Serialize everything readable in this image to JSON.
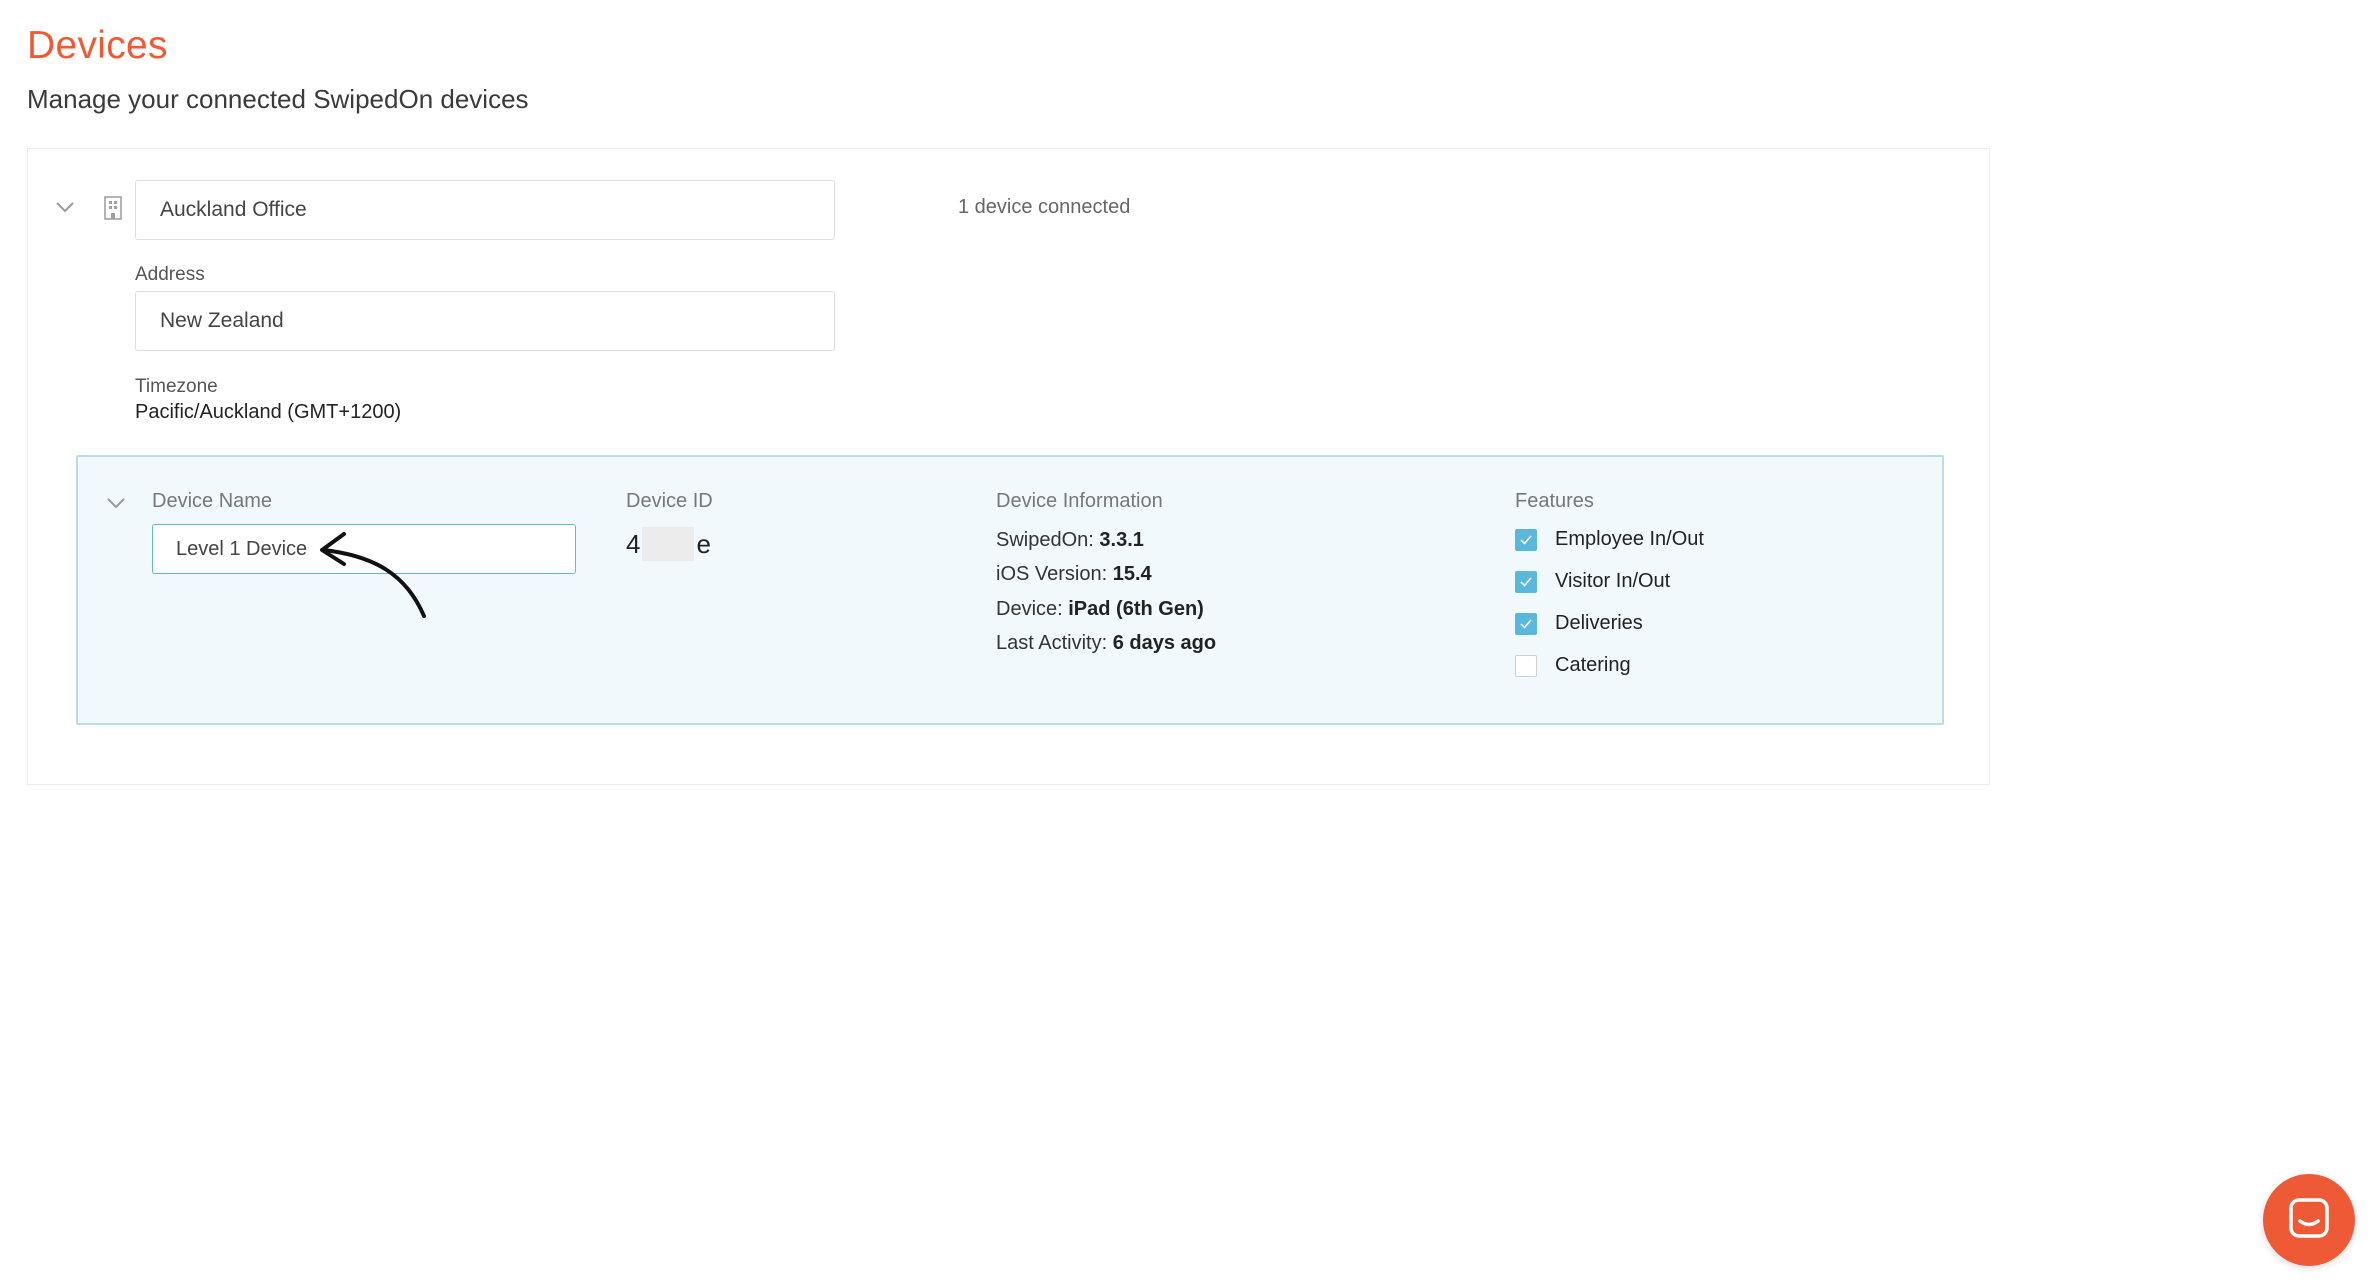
{
  "header": {
    "title": "Devices",
    "subtitle": "Manage your connected SwipedOn devices"
  },
  "location": {
    "name_value": "Auckland Office",
    "devices_connected": "1 device connected",
    "address_label": "Address",
    "address_value": "New Zealand",
    "timezone_label": "Timezone",
    "timezone_value": "Pacific/Auckland (GMT+1200)"
  },
  "device": {
    "name_header": "Device Name",
    "name_value": "Level 1 Device",
    "id_header": "Device ID",
    "id_prefix": "4",
    "id_suffix": "e",
    "info_header": "Device Information",
    "info": [
      {
        "label": "SwipedOn: ",
        "value": "3.3.1"
      },
      {
        "label": "iOS Version: ",
        "value": "15.4"
      },
      {
        "label": "Device: ",
        "value": "iPad (6th Gen)"
      },
      {
        "label": "Last Activity: ",
        "value": "6 days ago"
      }
    ],
    "features_header": "Features",
    "features": [
      {
        "label": "Employee In/Out",
        "checked": true
      },
      {
        "label": "Visitor In/Out",
        "checked": true
      },
      {
        "label": "Deliveries",
        "checked": true
      },
      {
        "label": "Catering",
        "checked": false
      }
    ]
  },
  "icons": {
    "location_collapse": "chevron-down-icon",
    "building": "building-icon",
    "device_collapse": "chevron-down-icon",
    "chat": "chat-icon",
    "annotation": "curved-arrow-icon"
  },
  "colors": {
    "brand": "#ee5a36",
    "accent": "#5ab8dd",
    "panel_background": "#f2f9fc",
    "panel_border": "#b9dcea"
  }
}
